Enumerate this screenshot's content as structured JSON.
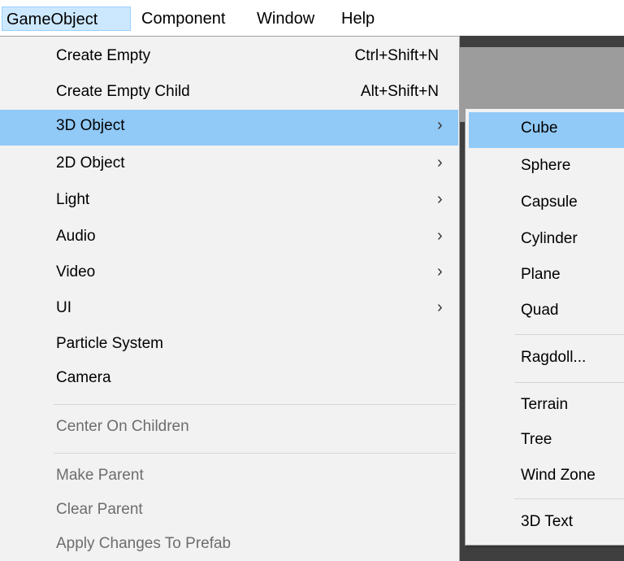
{
  "menubar": [
    {
      "label": "GameObject"
    },
    {
      "label": "Component"
    },
    {
      "label": "Window"
    },
    {
      "label": "Help"
    }
  ],
  "menu": {
    "items": [
      {
        "label": "Create Empty",
        "shortcut": "Ctrl+Shift+N"
      },
      {
        "label": "Create Empty Child",
        "shortcut": "Alt+Shift+N"
      },
      {
        "label": "3D Object",
        "arrow": "›"
      },
      {
        "label": "2D Object",
        "arrow": "›"
      },
      {
        "label": "Light",
        "arrow": "›"
      },
      {
        "label": "Audio",
        "arrow": "›"
      },
      {
        "label": "Video",
        "arrow": "›"
      },
      {
        "label": "UI",
        "arrow": "›"
      },
      {
        "label": "Particle System"
      },
      {
        "label": "Camera"
      },
      {
        "label": "Center On Children"
      },
      {
        "label": "Make Parent"
      },
      {
        "label": "Clear Parent"
      },
      {
        "label": "Apply Changes To Prefab"
      }
    ]
  },
  "submenu": {
    "items": [
      {
        "label": "Cube"
      },
      {
        "label": "Sphere"
      },
      {
        "label": "Capsule"
      },
      {
        "label": "Cylinder"
      },
      {
        "label": "Plane"
      },
      {
        "label": "Quad"
      },
      {
        "label": "Ragdoll..."
      },
      {
        "label": "Terrain"
      },
      {
        "label": "Tree"
      },
      {
        "label": "Wind Zone"
      },
      {
        "label": "3D Text"
      }
    ]
  },
  "colors": {
    "highlight": "#91c9f7",
    "menu_background": "#f2f2f2",
    "disabled_text": "#6d6d6d"
  },
  "icons": {
    "submenu_arrow": "chevron-right-icon"
  }
}
